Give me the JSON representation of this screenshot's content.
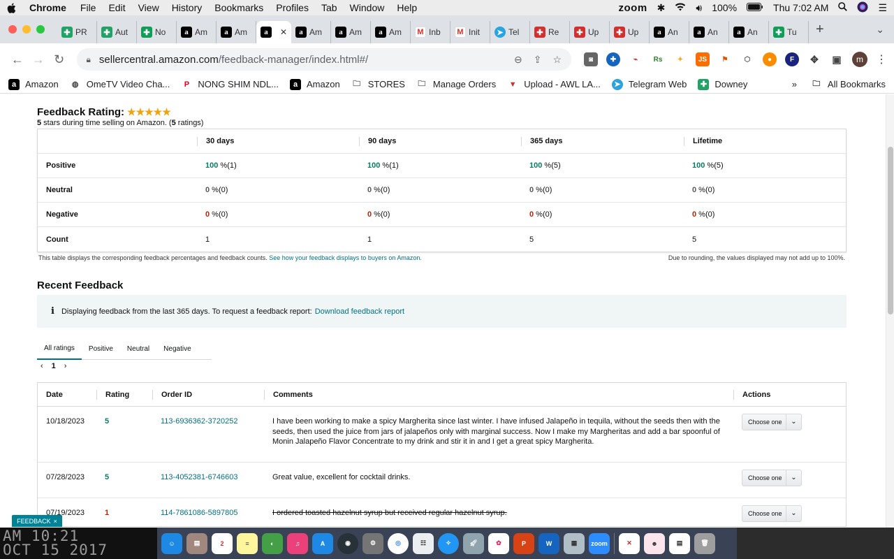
{
  "menubar": {
    "app": "Chrome",
    "items": [
      "File",
      "Edit",
      "View",
      "History",
      "Bookmarks",
      "Profiles",
      "Tab",
      "Window",
      "Help"
    ],
    "zoom": "zoom",
    "battery": "100%",
    "clock": "Thu 7:02 AM"
  },
  "tabs": [
    {
      "label": "PR",
      "icon": "sheet"
    },
    {
      "label": "Aut",
      "icon": "sheet"
    },
    {
      "label": "No",
      "icon": "grn"
    },
    {
      "label": "Am",
      "icon": "amz"
    },
    {
      "label": "Am",
      "icon": "amz"
    },
    {
      "label": "",
      "icon": "amz",
      "active": true
    },
    {
      "label": "Am",
      "icon": "amz"
    },
    {
      "label": "Am",
      "icon": "amz"
    },
    {
      "label": "Am",
      "icon": "amz"
    },
    {
      "label": "Inb",
      "icon": "gm"
    },
    {
      "label": "Init",
      "icon": "gm"
    },
    {
      "label": "Tel",
      "icon": "tg"
    },
    {
      "label": "Re",
      "icon": "red"
    },
    {
      "label": "Up",
      "icon": "red"
    },
    {
      "label": "Up",
      "icon": "red"
    },
    {
      "label": "An",
      "icon": "amz"
    },
    {
      "label": "An",
      "icon": "amz"
    },
    {
      "label": "An",
      "icon": "amz"
    },
    {
      "label": "Tu",
      "icon": "grn"
    }
  ],
  "address": {
    "host": "sellercentral.amazon.com",
    "path": "/feedback-manager/index.html#/"
  },
  "bookmarks": [
    {
      "label": "Amazon",
      "icon": "amz"
    },
    {
      "label": "OmeTV Video Cha...",
      "icon": "globe"
    },
    {
      "label": "NONG SHIM NDL...",
      "icon": "pin"
    },
    {
      "label": "Amazon",
      "icon": "amz"
    },
    {
      "label": "STORES",
      "icon": "folder"
    },
    {
      "label": "Manage Orders",
      "icon": "folder"
    },
    {
      "label": "Upload - AWL LA...",
      "icon": "red"
    },
    {
      "label": "Telegram Web",
      "icon": "tg"
    },
    {
      "label": "Downey",
      "icon": "sheet"
    }
  ],
  "bookmarks_more": "»",
  "all_bookmarks": "All Bookmarks",
  "rating": {
    "title": "Feedback Rating:",
    "stars": "★★★★★",
    "sub_stars": "5",
    "sub_text_1": " stars during time selling on Amazon. (",
    "sub_count": "5",
    "sub_text_2": " ratings)"
  },
  "feedback_table": {
    "headers": [
      "",
      "30 days",
      "90 days",
      "365 days",
      "Lifetime"
    ],
    "rows": [
      {
        "label": "Positive",
        "cells": [
          [
            "100",
            " %(1)"
          ],
          [
            "100",
            " %(1)"
          ],
          [
            "100",
            " %(5)"
          ],
          [
            "100",
            " %(5)"
          ]
        ]
      },
      {
        "label": "Neutral",
        "cells": [
          [
            "0",
            " %(0)"
          ],
          [
            "0",
            " %(0)"
          ],
          [
            "0",
            " %(0)"
          ],
          [
            "0",
            " %(0)"
          ]
        ]
      },
      {
        "label": "Negative",
        "cells": [
          [
            "0",
            " %(0)"
          ],
          [
            "0",
            " %(0)"
          ],
          [
            "0",
            " %(0)"
          ],
          [
            "0",
            " %(0)"
          ]
        ]
      },
      {
        "label": "Count",
        "cells": [
          [
            "",
            "1"
          ],
          [
            "",
            "1"
          ],
          [
            "",
            "5"
          ],
          [
            "",
            "5"
          ]
        ]
      }
    ]
  },
  "notes": {
    "left": "This table displays the corresponding feedback percentages and feedback counts.",
    "left_link": "See how your feedback displays to buyers on Amazon.",
    "right": "Due to rounding, the values displayed may not add up to 100%."
  },
  "recent": {
    "title": "Recent Feedback",
    "info": "Displaying feedback from the last 365 days. To request a feedback report:",
    "info_link": "Download feedback report",
    "tabs": [
      "All ratings",
      "Positive",
      "Neutral",
      "Negative"
    ],
    "page": "1",
    "columns": [
      "Date",
      "Rating",
      "Order ID",
      "Comments",
      "Actions"
    ],
    "rows": [
      {
        "date": "10/18/2023",
        "rating": "5",
        "order": "113-6936362-3720252",
        "comment": "I have been working to make a spicy Margherita since last winter. I have infused Jalapeño in tequila, without the seeds then with the seeds, then used the juice from jars of jalapeños only with marginal success. Now I make my Margheritas and add a bar spoonful of Monin Jalapeño Flavor Concentrate to my drink and stir it in and I get a great spicy Margherita.",
        "action": "Choose one"
      },
      {
        "date": "07/28/2023",
        "rating": "5",
        "order": "113-4052381-6746603",
        "comment": "Great value, excellent for cocktail drinks.",
        "action": "Choose one"
      },
      {
        "date": "07/19/2023",
        "rating": "1",
        "order": "114-7861086-5897805",
        "comment": "I ordered toasted hazelnut syrup but received regular hazelnut syrup.",
        "action": "Choose one"
      }
    ]
  },
  "feedback_tab": {
    "label": "FEEDBACK",
    "close": "×"
  },
  "desktop_clock": "AM 10:21\nOCT 15 2017",
  "colors": {
    "positive": "#067d62",
    "negative": "#b12704",
    "link": "#007185",
    "star": "#f0a30a"
  }
}
